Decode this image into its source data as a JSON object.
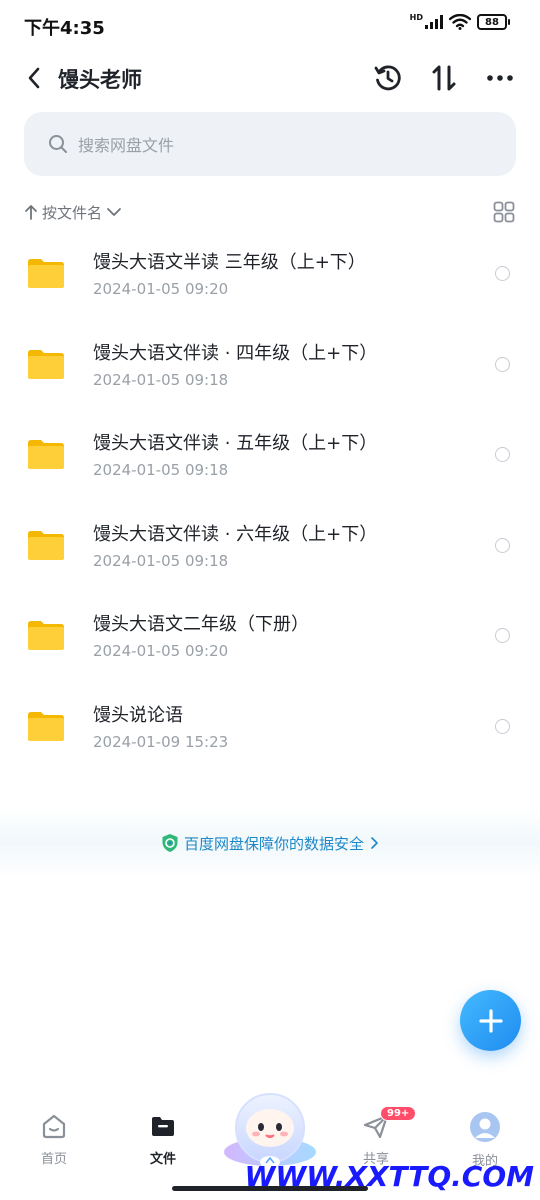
{
  "status_bar": {
    "time": "下午4:35",
    "network": "HD",
    "battery": "88"
  },
  "header": {
    "title": "馒头老师"
  },
  "search": {
    "placeholder": "搜索网盘文件"
  },
  "sort": {
    "label": "按文件名"
  },
  "files": [
    {
      "name": "馒头大语文半读 三年级（上+下）",
      "date": "2024-01-05  09:20"
    },
    {
      "name": "馒头大语文伴读 · 四年级（上+下）",
      "date": "2024-01-05  09:18"
    },
    {
      "name": "馒头大语文伴读 · 五年级（上+下）",
      "date": "2024-01-05  09:18"
    },
    {
      "name": "馒头大语文伴读 · 六年级（上+下）",
      "date": "2024-01-05  09:18"
    },
    {
      "name": "馒头大语文二年级（下册）",
      "date": "2024-01-05  09:20"
    },
    {
      "name": "馒头说论语",
      "date": "2024-01-09  15:23"
    }
  ],
  "banner": {
    "text": "百度网盘保障你的数据安全"
  },
  "tabs": [
    {
      "label": "首页",
      "icon": "home-icon"
    },
    {
      "label": "文件",
      "icon": "folder-icon",
      "active": true
    },
    {
      "label": "共享",
      "icon": "send-icon",
      "badge": "99+"
    },
    {
      "label": "我的",
      "icon": "avatar-icon"
    }
  ],
  "watermark": "WWW.XXTTQ.COM",
  "colors": {
    "accent": "#1e8cf0",
    "folder": "#ffc82c",
    "banner_text": "#1e88c8",
    "badge": "#ff4d6a"
  }
}
